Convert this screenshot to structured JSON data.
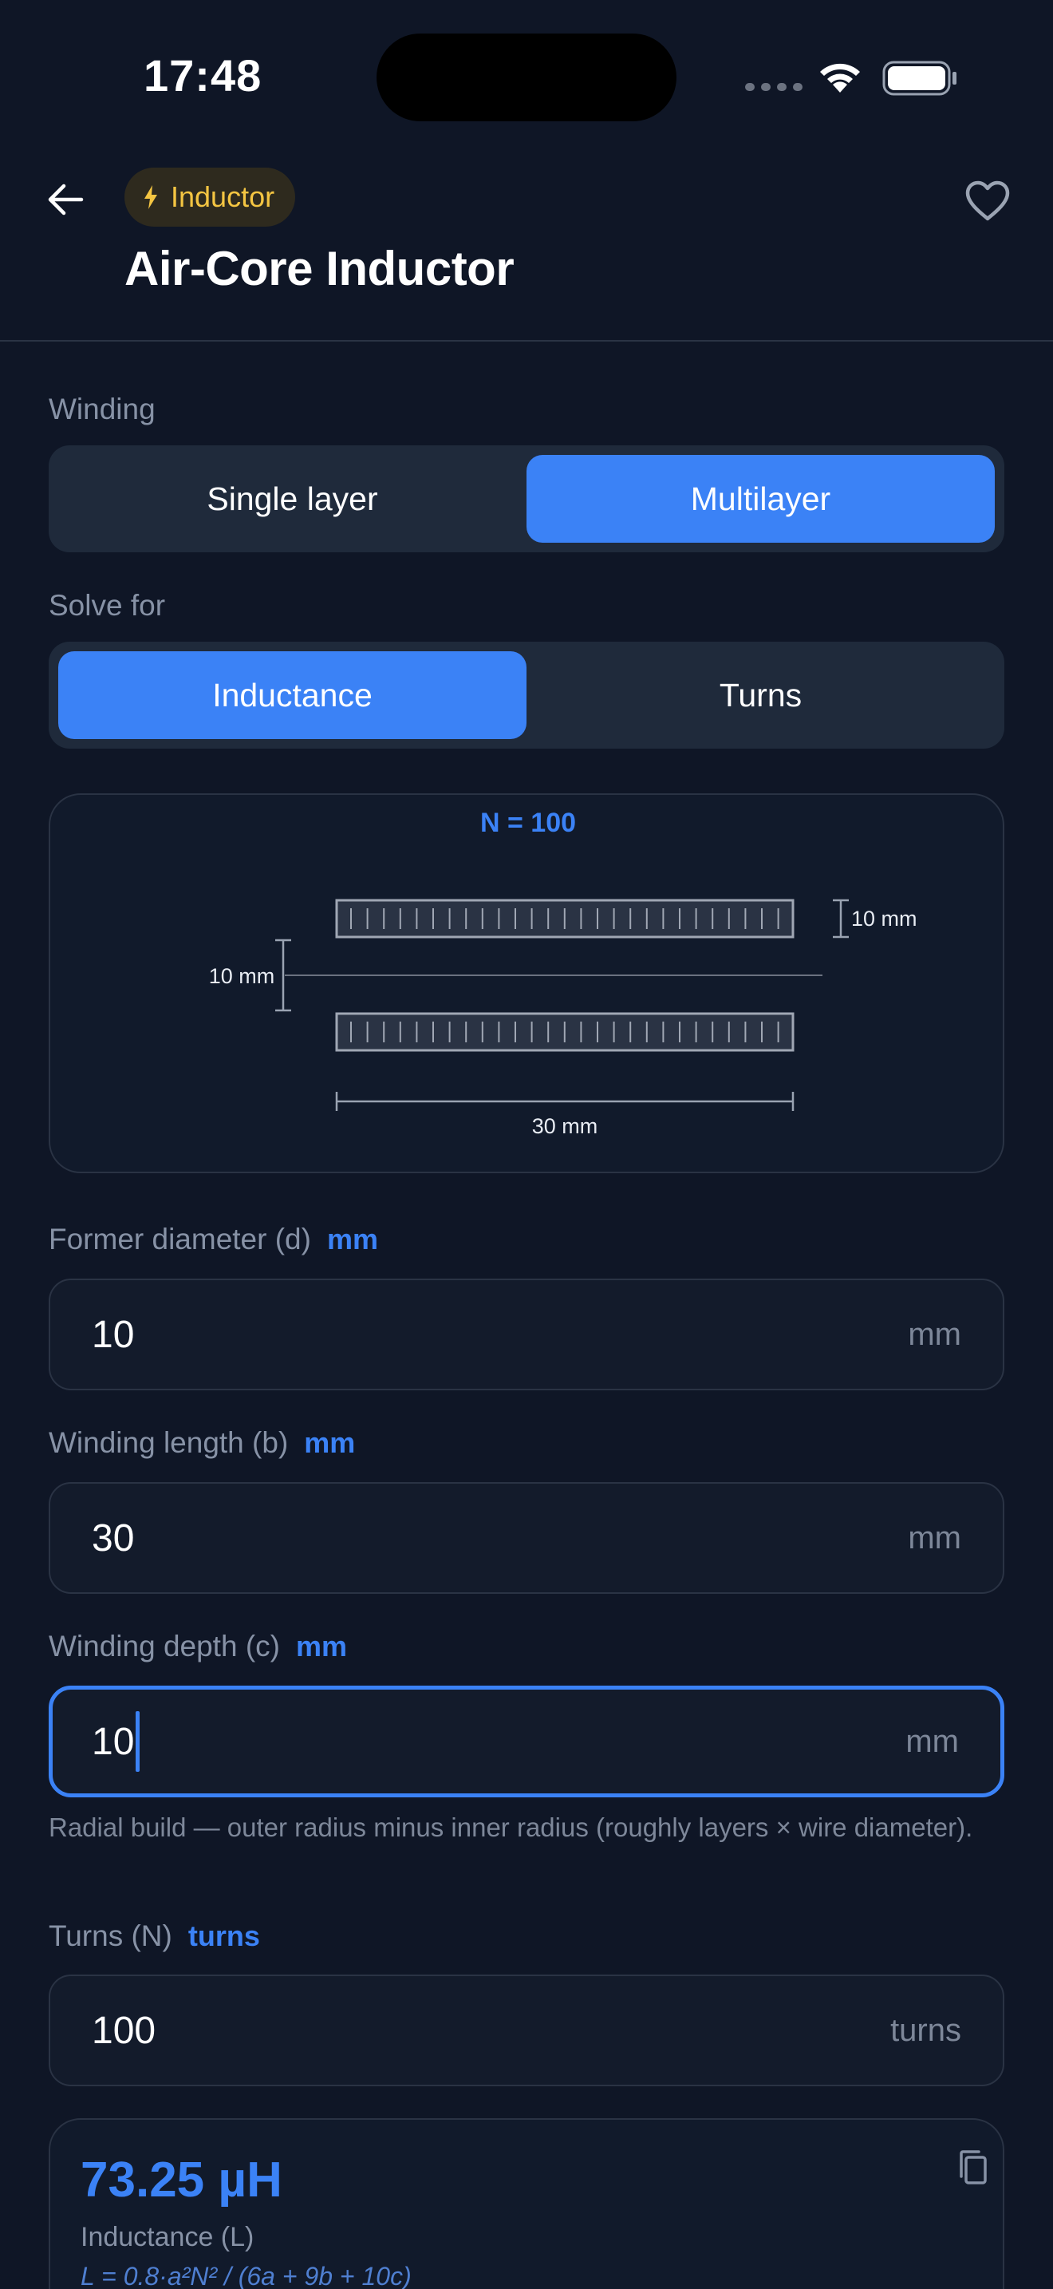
{
  "status": {
    "time": "17:48"
  },
  "header": {
    "badge": "Inductor",
    "title": "Air-Core Inductor"
  },
  "winding": {
    "label": "Winding",
    "options": [
      "Single layer",
      "Multilayer"
    ],
    "selected": "Multilayer"
  },
  "solve_for": {
    "label": "Solve for",
    "options": [
      "Inductance",
      "Turns"
    ],
    "selected": "Inductance"
  },
  "diagram": {
    "turns_label": "N = 100",
    "diameter_label": "10 mm",
    "depth_label": "10 mm",
    "length_label": "30 mm"
  },
  "fields": {
    "diameter": {
      "label": "Former diameter (d)",
      "unit_tag": "mm",
      "value": "10",
      "suffix": "mm"
    },
    "length": {
      "label": "Winding length (b)",
      "unit_tag": "mm",
      "value": "30",
      "suffix": "mm"
    },
    "depth": {
      "label": "Winding depth (c)",
      "unit_tag": "mm",
      "value": "10",
      "suffix": "mm",
      "help": "Radial build — outer radius minus inner radius (roughly layers × wire diameter)."
    },
    "turns": {
      "label": "Turns (N)",
      "unit_tag": "turns",
      "value": "100",
      "suffix": "turns"
    }
  },
  "result": {
    "value": "73.25 µH",
    "label": "Inductance (L)",
    "formula": "L = 0.8·a²N² / (6a + 9b + 10c)"
  },
  "colors": {
    "accent": "#3b82f6",
    "badge_text": "#f4c542",
    "background": "#0f1626"
  }
}
